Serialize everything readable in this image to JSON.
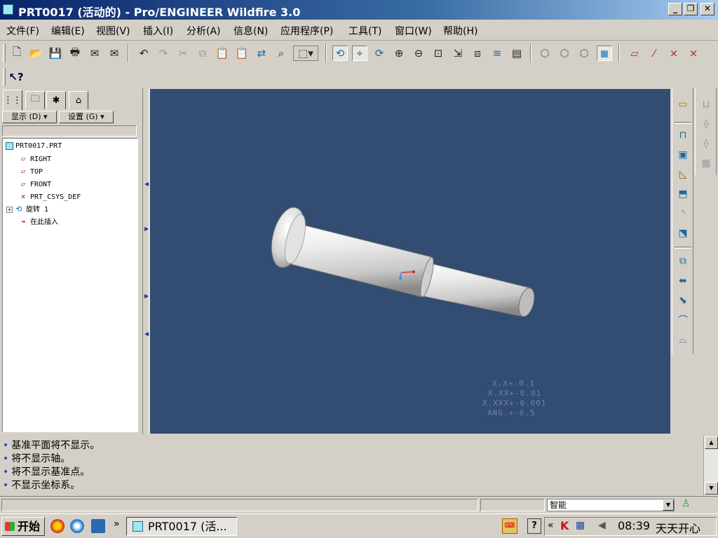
{
  "window": {
    "title": "PRT0017 (活动的) - Pro/ENGINEER Wildfire 3.0",
    "minimize": "_",
    "restore": "❐",
    "close": "✕"
  },
  "menu": [
    "文件(F)",
    "编辑(E)",
    "视图(V)",
    "插入(I)",
    "分析(A)",
    "信息(N)",
    "应用程序(P)",
    "工具(T)",
    "窗口(W)",
    "帮助(H)"
  ],
  "left_panel": {
    "show_button": "显示 (D) ▾",
    "settings_button": "设置 (G) ▾",
    "tree": [
      {
        "label": "PRT0017.PRT",
        "icon": "part-icon"
      },
      {
        "label": "RIGHT",
        "icon": "datum-plane-icon"
      },
      {
        "label": "TOP",
        "icon": "datum-plane-icon"
      },
      {
        "label": "FRONT",
        "icon": "datum-plane-icon"
      },
      {
        "label": "PRT_CSYS_DEF",
        "icon": "csys-icon"
      },
      {
        "label": "旋转 1",
        "icon": "revolve-icon"
      },
      {
        "label": "在此插入",
        "icon": "insert-here-arrow-icon"
      }
    ]
  },
  "viewport": {
    "background": "#334c72",
    "tolerances": [
      "X.X+-0.1",
      "X.XX+-0.01",
      "X.XXX+-0.001",
      "ANG.+-0.5"
    ]
  },
  "messages": [
    "基准平面将不显示。",
    "将不显示轴。",
    "将不显示基准点。",
    "不显示坐标系。"
  ],
  "status": {
    "filter_value": "智能"
  },
  "taskbar": {
    "start": "开始",
    "task": "PRT0017 (活...",
    "clock": "08:39",
    "tray_name": "天天开心",
    "show_more": "»",
    "tray_more": "«"
  }
}
